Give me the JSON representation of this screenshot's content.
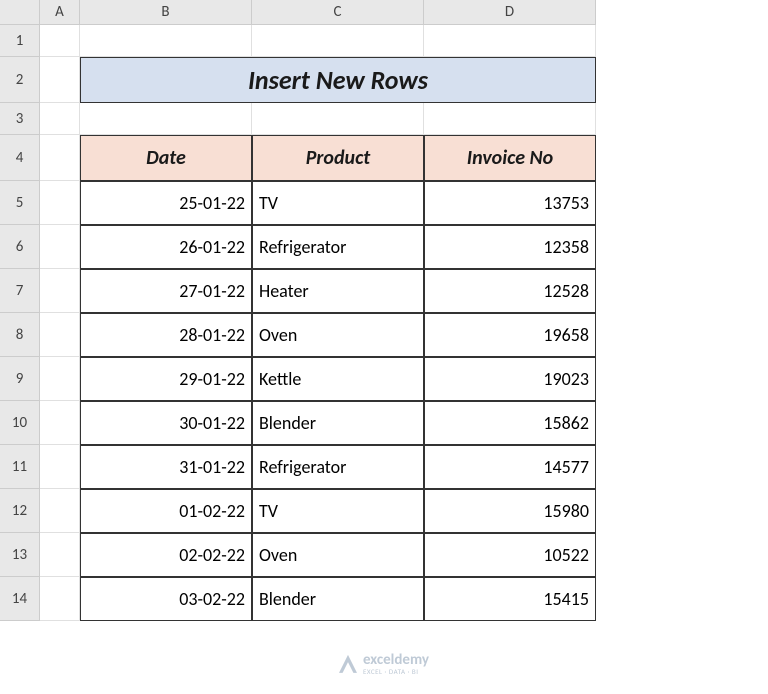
{
  "columns": [
    "A",
    "B",
    "C",
    "D"
  ],
  "row_numbers": [
    "1",
    "2",
    "3",
    "4",
    "5",
    "6",
    "7",
    "8",
    "9",
    "10",
    "11",
    "12",
    "13",
    "14"
  ],
  "title": "Insert New Rows",
  "headers": {
    "date": "Date",
    "product": "Product",
    "invoice": "Invoice No"
  },
  "rows": [
    {
      "date": "25-01-22",
      "product": "TV",
      "invoice": "13753"
    },
    {
      "date": "26-01-22",
      "product": "Refrigerator",
      "invoice": "12358"
    },
    {
      "date": "27-01-22",
      "product": "Heater",
      "invoice": "12528"
    },
    {
      "date": "28-01-22",
      "product": "Oven",
      "invoice": "19658"
    },
    {
      "date": "29-01-22",
      "product": "Kettle",
      "invoice": "19023"
    },
    {
      "date": "30-01-22",
      "product": "Blender",
      "invoice": "15862"
    },
    {
      "date": "31-01-22",
      "product": "Refrigerator",
      "invoice": "14577"
    },
    {
      "date": "01-02-22",
      "product": "TV",
      "invoice": "15980"
    },
    {
      "date": "02-02-22",
      "product": "Oven",
      "invoice": "10522"
    },
    {
      "date": "03-02-22",
      "product": "Blender",
      "invoice": "15415"
    }
  ],
  "watermark": {
    "main": "exceldemy",
    "sub": "EXCEL · DATA · BI"
  }
}
